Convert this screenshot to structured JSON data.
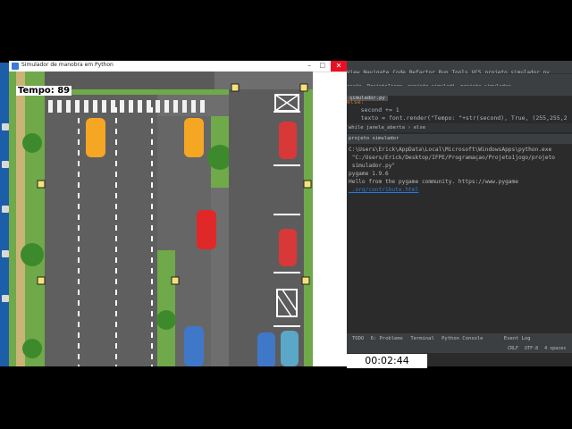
{
  "game": {
    "window_title": "Simulador de manobra em Python",
    "tempo_label": "Tempo: 89"
  },
  "ide": {
    "menu": [
      "View",
      "Navigate",
      "Code",
      "Refactor",
      "Run",
      "Tools",
      "VCS",
      "projeto simulador.py"
    ],
    "toolbar": [
      "ração",
      "Projeto1jogo",
      "projeto simuladi",
      "projeto simulador"
    ],
    "file_tab": "simulador.py",
    "code_lines": [
      "else:",
      "    second += 1",
      "    texto = font.render(\"Tempo: \"+str(second), True, (255,255,2"
    ],
    "breadcrumb": [
      "while janela_aberta",
      "else"
    ],
    "run_tab": "projeto simulador",
    "console_lines": [
      "C:\\Users\\Erick\\AppData\\Local\\Microsoft\\WindowsApps\\python.exe",
      " \"C:/Users/Erick/Desktop/IFPE/Programaçao/Projeto1jogo/projeto",
      " simulador.py\"",
      "pygame 1.9.6",
      "Hello from the pygame community. https://www.pygame",
      " .org/contribute.html"
    ],
    "bottom_tabs": [
      "TODO",
      "6: Problems",
      "Terminal",
      "Python Console",
      "Event Log"
    ],
    "status": [
      "CRLF",
      "UTF-8",
      "4 spaces"
    ]
  },
  "clock": "00:02:44"
}
